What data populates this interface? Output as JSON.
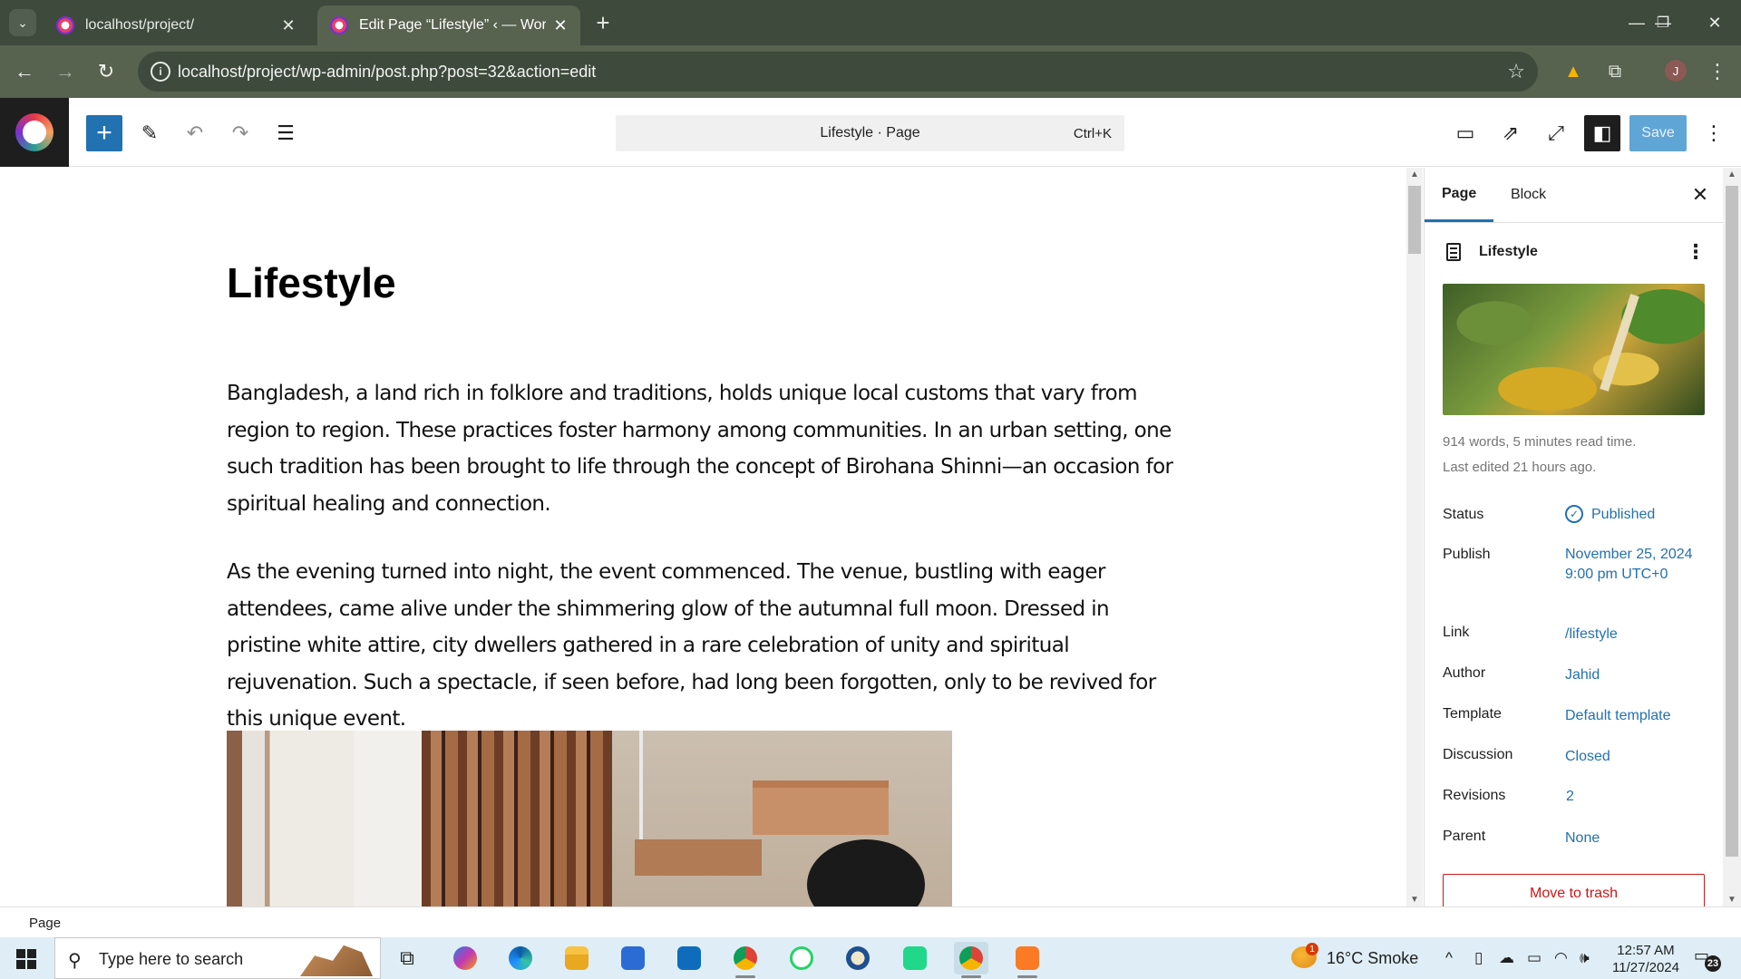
{
  "browser": {
    "tabs": [
      {
        "title": "localhost/project/"
      },
      {
        "title": "Edit Page “Lifestyle” ‹ — WordP"
      }
    ],
    "url": "localhost/project/wp-admin/post.php?post=32&action=edit",
    "profile_initial": "J"
  },
  "editor": {
    "command_bar": {
      "title": "Lifestyle · Page",
      "shortcut": "Ctrl+K"
    },
    "save_label": "Save",
    "page_title": "Lifestyle",
    "paragraphs": [
      "Bangladesh, a land rich in folklore and traditions, holds unique local customs that vary from region to region. These practices foster harmony among communities. In an urban setting, one such tradition has been brought to life through the concept of Birohana Shinni—an occasion for spiritual healing and connection.",
      "As the evening turned into night, the event commenced. The venue, bustling with eager attendees, came alive under the shimmering glow of the autumnal full moon. Dressed in pristine white attire, city dwellers gathered in a rare celebration of unity and spiritual rejuvenation. Such a spectacle, if seen before, had long been forgotten, only to be revived for this unique event."
    ],
    "footer_breadcrumb": "Page"
  },
  "sidebar": {
    "tabs": [
      "Page",
      "Block"
    ],
    "doc_title": "Lifestyle",
    "meta_words": "914 words, 5 minutes read time.",
    "meta_edited": "Last edited 21 hours ago.",
    "rows": [
      {
        "label": "Status",
        "value": "Published"
      },
      {
        "label": "Publish",
        "value": "November 25, 2024 9:00 pm UTC+0"
      },
      {
        "label": "Link",
        "value": "/lifestyle"
      },
      {
        "label": "Author",
        "value": "Jahid"
      },
      {
        "label": "Template",
        "value": "Default template"
      },
      {
        "label": "Discussion",
        "value": "Closed"
      },
      {
        "label": "Revisions",
        "value": "2"
      },
      {
        "label": "Parent",
        "value": "None"
      }
    ],
    "trash_label": "Move to trash"
  },
  "taskbar": {
    "search_placeholder": "Type here to search",
    "weather": "16°C  Smoke",
    "weather_badge": "1",
    "time": "12:57 AM",
    "date": "11/27/2024",
    "notifications": "23"
  },
  "colors": {
    "accent": "#2271b1",
    "danger": "#cc1818",
    "chrome_dark": "#3d4a3c",
    "chrome_toolbar": "#57624f"
  }
}
